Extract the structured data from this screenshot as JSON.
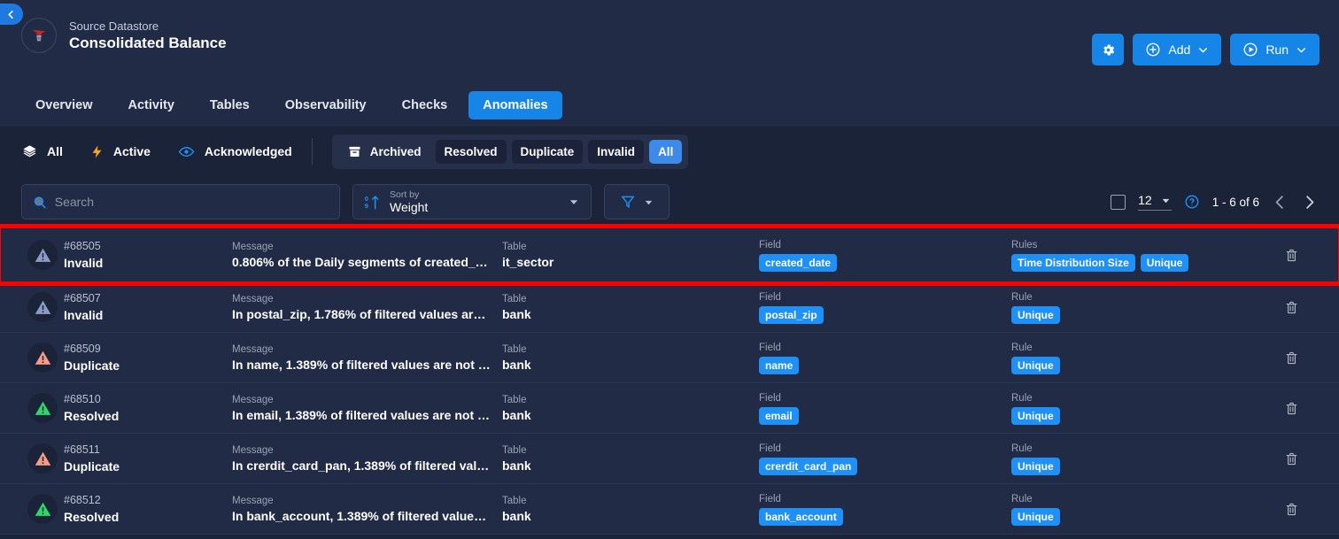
{
  "header": {
    "back_icon": "chevron-left-icon",
    "datastore_label": "Source Datastore",
    "datastore_name": "Consolidated Balance",
    "settings_icon": "gear-icon",
    "add_label": "Add",
    "add_icon": "plus-circle-icon",
    "run_label": "Run",
    "run_icon": "play-circle-icon",
    "caret_icon": "chevron-down-icon"
  },
  "tabs": [
    {
      "label": "Overview",
      "active": false
    },
    {
      "label": "Activity",
      "active": false
    },
    {
      "label": "Tables",
      "active": false
    },
    {
      "label": "Observability",
      "active": false
    },
    {
      "label": "Checks",
      "active": false
    },
    {
      "label": "Anomalies",
      "active": true
    }
  ],
  "filters": {
    "left": [
      {
        "label": "All",
        "icon": "layers-icon"
      },
      {
        "label": "Active",
        "icon": "lightning-bolt-icon"
      },
      {
        "label": "Acknowledged",
        "icon": "eye-icon"
      }
    ],
    "chips": [
      {
        "label": "Archived",
        "style": "plain",
        "icon": "archive-icon"
      },
      {
        "label": "Resolved",
        "style": "dark"
      },
      {
        "label": "Duplicate",
        "style": "dark"
      },
      {
        "label": "Invalid",
        "style": "dark"
      },
      {
        "label": "All",
        "style": "sel"
      }
    ]
  },
  "toolbar": {
    "search_placeholder": "Search",
    "search_value": "",
    "search_icon": "search-icon",
    "sort_label": "Sort by",
    "sort_value": "Weight",
    "sort_icon": "sort-numeric-asc-icon",
    "filter_icon": "funnel-icon",
    "page_size": "12",
    "help_icon": "help-circle-icon",
    "range_text": "1 - 6 of 6",
    "prev_icon": "chevron-left-icon",
    "next_icon": "chevron-right-icon"
  },
  "columns": {
    "message": "Message",
    "table": "Table",
    "field": "Field",
    "rule": "Rule",
    "rules": "Rules"
  },
  "colors": {
    "accent": "#1586e8",
    "highlight": "#fe0000",
    "status_invalid": "#8c9bc4",
    "status_duplicate": "#f79a86",
    "status_resolved": "#2bd96b",
    "tag": "#1e90f6"
  },
  "rows": [
    {
      "id": "#68505",
      "status": "Invalid",
      "status_kind": "invalid",
      "message": "0.806% of the Daily segments of created_dat…",
      "table": "it_sector",
      "field": "created_date",
      "rules_header": "Rules",
      "rules": [
        "Time Distribution Size",
        "Unique"
      ],
      "highlighted": true,
      "delete_icon": "trash-icon"
    },
    {
      "id": "#68507",
      "status": "Invalid",
      "status_kind": "invalid",
      "message": "In postal_zip, 1.786% of filtered values are not …",
      "table": "bank",
      "field": "postal_zip",
      "rules_header": "Rule",
      "rules": [
        "Unique"
      ],
      "highlighted": false,
      "delete_icon": "trash-icon"
    },
    {
      "id": "#68509",
      "status": "Duplicate",
      "status_kind": "duplicate",
      "message": "In name, 1.389% of filtered values are not uniq…",
      "table": "bank",
      "field": "name",
      "rules_header": "Rule",
      "rules": [
        "Unique"
      ],
      "highlighted": false,
      "delete_icon": "trash-icon"
    },
    {
      "id": "#68510",
      "status": "Resolved",
      "status_kind": "resolved",
      "message": "In email, 1.389% of filtered values are not unique",
      "table": "bank",
      "field": "email",
      "rules_header": "Rule",
      "rules": [
        "Unique"
      ],
      "highlighted": false,
      "delete_icon": "trash-icon"
    },
    {
      "id": "#68511",
      "status": "Duplicate",
      "status_kind": "duplicate",
      "message": "In crerdit_card_pan, 1.389% of filtered values …",
      "table": "bank",
      "field": "crerdit_card_pan",
      "rules_header": "Rule",
      "rules": [
        "Unique"
      ],
      "highlighted": false,
      "delete_icon": "trash-icon"
    },
    {
      "id": "#68512",
      "status": "Resolved",
      "status_kind": "resolved",
      "message": "In bank_account, 1.389% of filtered values are …",
      "table": "bank",
      "field": "bank_account",
      "rules_header": "Rule",
      "rules": [
        "Unique"
      ],
      "highlighted": false,
      "delete_icon": "trash-icon"
    }
  ]
}
